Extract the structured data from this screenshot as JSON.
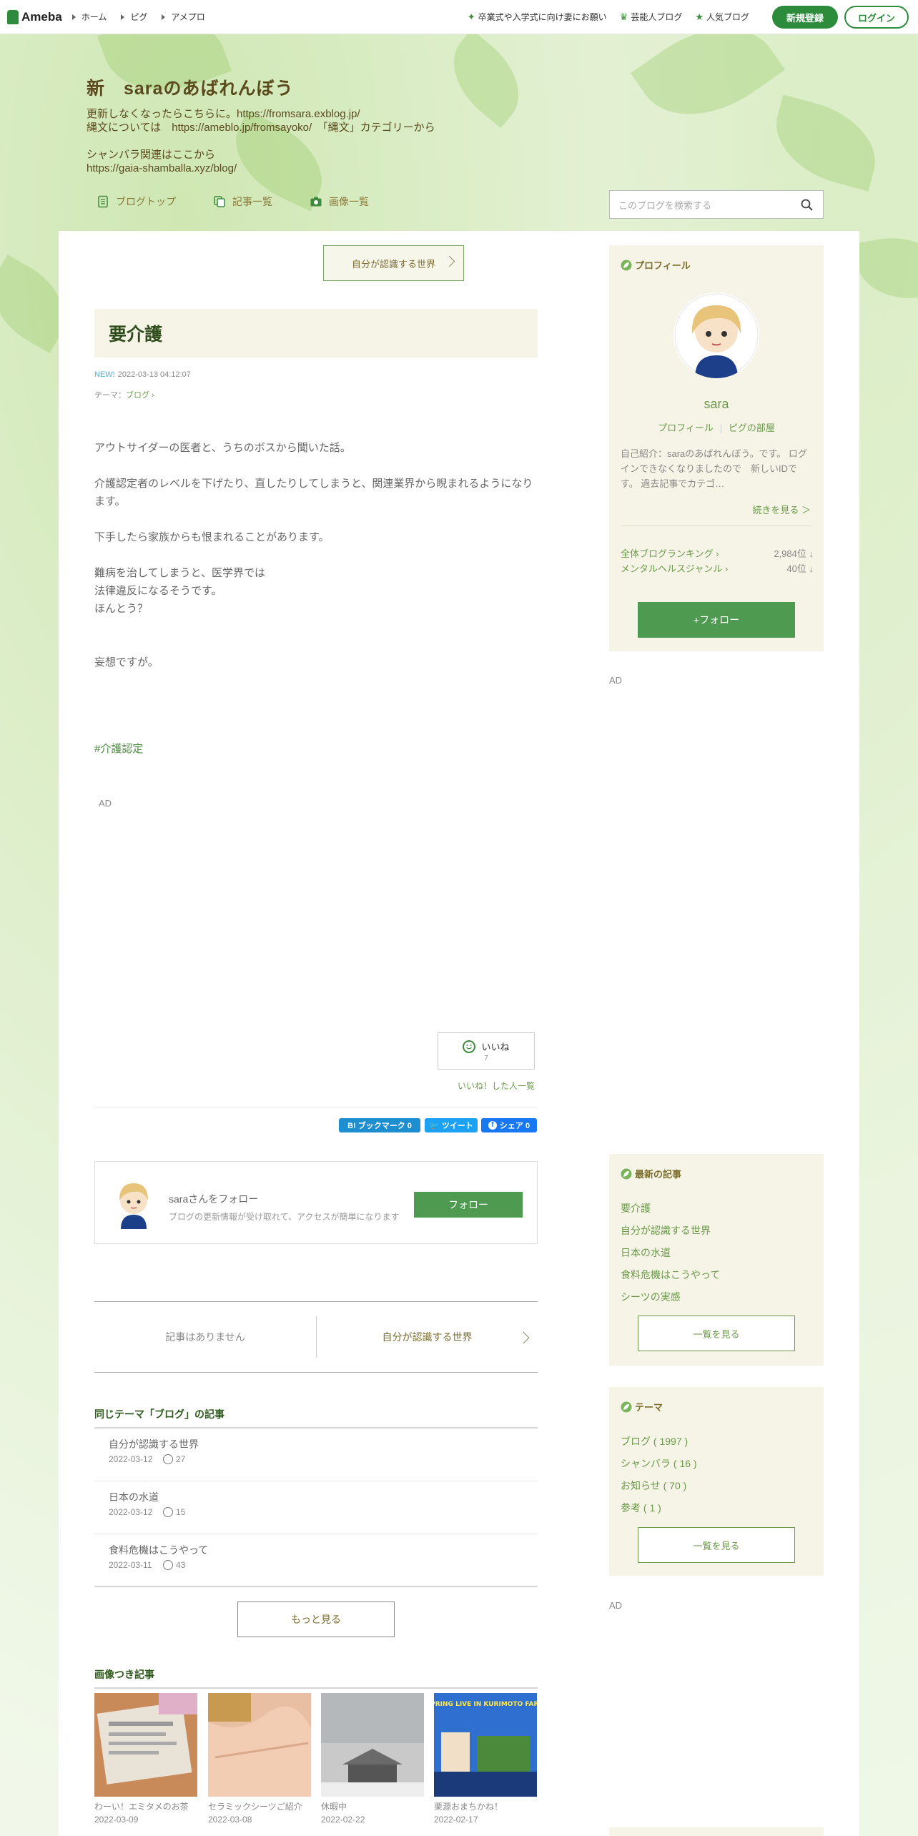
{
  "topbar": {
    "logo": "Ameba",
    "nav": [
      "ホーム",
      "ピグ",
      "アメプロ"
    ],
    "links": [
      {
        "icon": "sparkle-icon",
        "label": "卒業式や入学式に向け妻にお願い"
      },
      {
        "icon": "crown-icon",
        "label": "芸能人ブログ"
      },
      {
        "icon": "star-icon",
        "label": "人気ブログ"
      }
    ],
    "register": "新規登録",
    "login": "ログイン"
  },
  "header": {
    "title": "新　saraのあばれんぼう",
    "description": "更新しなくなったらこちらに。https://fromsara.exblog.jp/\n縄文については　https://ameblo.jp/fromsayoko/　「縄文」カテゴリーから\n\nシャンバラ関連はここから\nhttps://gaia-shamballa.xyz/blog/"
  },
  "blog_nav": [
    "ブログトップ",
    "記事一覧",
    "画像一覧"
  ],
  "search": {
    "placeholder": "このブログを検索する"
  },
  "article": {
    "prev_link": "自分が認識する世界",
    "title": "要介護",
    "new_badge": "NEW!",
    "date": "2022-03-13 04:12:07",
    "theme_label": "テーマ：",
    "theme": "ブログ",
    "body": "アウトサイダーの医者と、うちのボスから聞いた話。\n\n介護認定者のレベルを下げたり、直したりしてしまうと、関連業界から睨まれるようになります。\n\n下手したら家族からも恨まれることがあります。\n\n難病を治してしまうと、医学界では\n法律違反になるそうです。\nほんとう？\n\n\n妄想ですが。",
    "hashtag": "#介護認定",
    "ad": "AD",
    "like_label": "いいね",
    "like_count": "7",
    "like_list": "いいね！した人一覧"
  },
  "share": {
    "hatena": "B! ブックマーク  0",
    "tweet": "ツイート",
    "facebook": "シェア 0"
  },
  "follow_box": {
    "title": "saraさんをフォロー",
    "desc": "ブログの更新情報が受け取れて、アクセスが簡単になります",
    "button": "フォロー"
  },
  "pager": {
    "prev": "記事はありません",
    "next": "自分が認識する世界"
  },
  "same_theme": {
    "heading": "同じテーマ「ブログ」の記事",
    "items": [
      {
        "title": "自分が認識する世界",
        "date": "2022-03-12",
        "likes": "27"
      },
      {
        "title": "日本の水道",
        "date": "2022-03-12",
        "likes": "15"
      },
      {
        "title": "食料危機はこうやって",
        "date": "2022-03-11",
        "likes": "43"
      }
    ],
    "more": "もっと見る"
  },
  "image_articles": {
    "heading": "画像つき記事",
    "items": [
      {
        "caption": "わーい！エミタメのお茶",
        "date": "2022-03-09"
      },
      {
        "caption": "セラミックシーツご紹介",
        "date": "2022-03-08"
      },
      {
        "caption": "休暇中",
        "date": "2022-02-22"
      },
      {
        "caption": "栗源おまちかね！",
        "date": "2022-02-17"
      }
    ],
    "poster_text": "SPRING LIVE IN KURIMOTO FARM"
  },
  "sidebar": {
    "profile": {
      "heading": "プロフィール",
      "name": "sara",
      "link_profile": "プロフィール",
      "link_room": "ピグの部屋",
      "intro": "自己紹介：saraのあばれんぼう。です。 ログインできなくなりましたので　新しいIDです。 過去記事でカテゴ…",
      "more": "続きを見る ＞",
      "ranking_all_label": "全体ブログランキング",
      "ranking_all_value": "2,984位 ↓",
      "ranking_genre_label": "メンタルヘルスジャンル",
      "ranking_genre_value": "40位 ↓",
      "follow": "+フォロー"
    },
    "ad": "AD",
    "latest": {
      "heading": "最新の記事",
      "items": [
        "要介護",
        "自分が認識する世界",
        "日本の水道",
        "食料危機はこうやって",
        "シーツの実感"
      ],
      "all": "一覧を見る"
    },
    "themes": {
      "heading": "テーマ",
      "items": [
        "ブログ ( 1997 )",
        "シャンバラ ( 16 )",
        "お知らせ ( 70 )",
        "参考 ( 1 )"
      ],
      "all": "一覧を見る"
    },
    "ad2": "AD"
  },
  "colors": {
    "brand_green": "#2d8c3c",
    "follow_green": "#4e9a50",
    "panel": "#f6f4e6"
  }
}
